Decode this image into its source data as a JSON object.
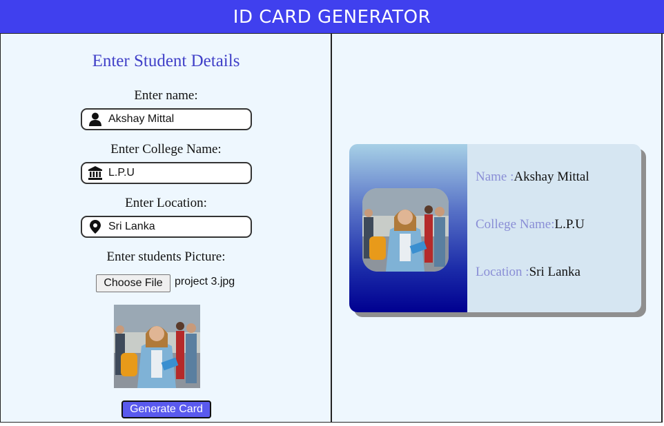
{
  "header": {
    "title": "ID CARD GENERATOR"
  },
  "form": {
    "title": "Enter Student Details",
    "name_label": "Enter name:",
    "name_value": "Akshay Mittal",
    "college_label": "Enter College Name:",
    "college_value": "L.P.U",
    "location_label": "Enter Location:",
    "location_value": "Sri Lanka",
    "picture_label": "Enter students Picture:",
    "choose_file_label": "Choose File",
    "file_name": "project 3.jpg",
    "generate_label": "Generate Card"
  },
  "card": {
    "name_key": "Name :",
    "name_value": "Akshay Mittal",
    "college_key": "College Name:",
    "college_value": "L.P.U",
    "location_key": "Location :",
    "location_value": "Sri Lanka"
  },
  "icons": {
    "name": "person-icon",
    "college": "bank-icon",
    "location": "map-pin-icon"
  },
  "colors": {
    "header": "#4040ee",
    "panel": "#eef7fe",
    "form_title": "#4040c8",
    "card_key": "#8a8ed6",
    "card_bg": "#d6e6f2",
    "button": "#5a5aee"
  }
}
